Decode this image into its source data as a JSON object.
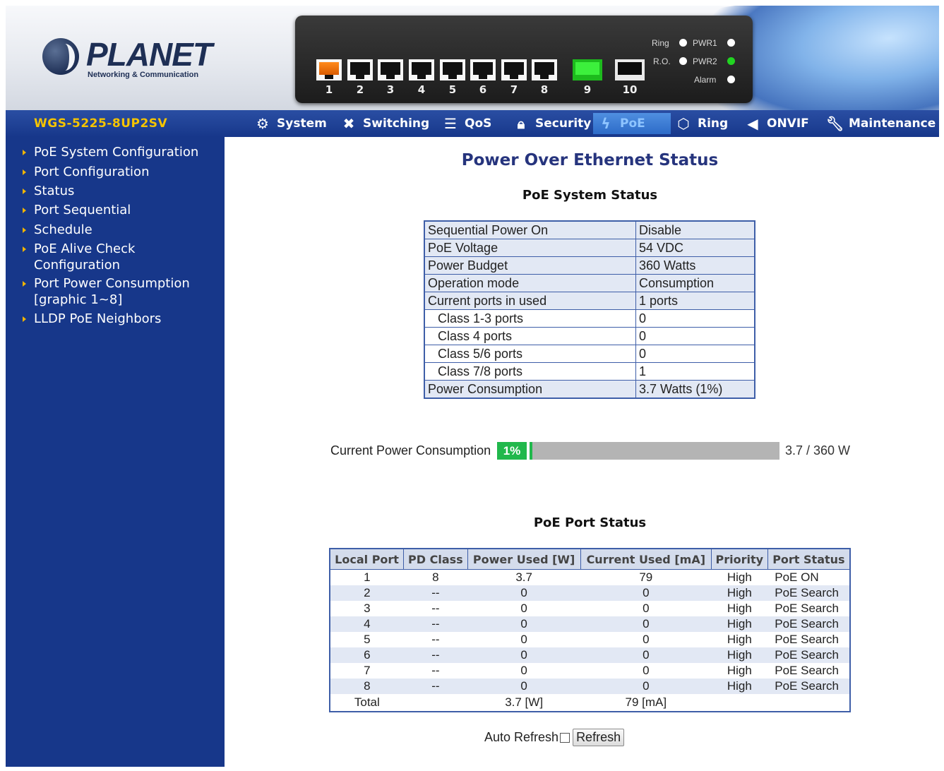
{
  "brand": {
    "name": "PLANET",
    "tagline": "Networking & Communication"
  },
  "device_panel": {
    "ports": [
      "1",
      "2",
      "3",
      "4",
      "5",
      "6",
      "7",
      "8",
      "9",
      "10"
    ],
    "active_port": "1",
    "leds": [
      {
        "label": "Ring",
        "state": "white"
      },
      {
        "label": "R.O.",
        "state": "white"
      },
      {
        "label": "PWR1",
        "state": "white"
      },
      {
        "label": "PWR2",
        "state": "green"
      },
      {
        "label": "Alarm",
        "state": "white"
      }
    ]
  },
  "header": {
    "model": "WGS-5225-8UP2SV",
    "nav": [
      {
        "label": "System",
        "icon": "gear-icon"
      },
      {
        "label": "Switching",
        "icon": "switching-icon"
      },
      {
        "label": "QoS",
        "icon": "qos-icon"
      },
      {
        "label": "Security",
        "icon": "lock-icon"
      },
      {
        "label": "PoE",
        "icon": "poe-icon",
        "current": true
      },
      {
        "label": "Ring",
        "icon": "ring-icon"
      },
      {
        "label": "ONVIF",
        "icon": "camera-icon"
      },
      {
        "label": "Maintenance",
        "icon": "wrench-icon"
      }
    ]
  },
  "sidebar": {
    "items": [
      {
        "label": "PoE System Configuration"
      },
      {
        "label": "Port Configuration"
      },
      {
        "label": "Status"
      },
      {
        "label": "Port Sequential"
      },
      {
        "label": "Schedule"
      },
      {
        "label": "PoE Alive Check\nConfiguration"
      },
      {
        "label": "Port Power Consumption\n[graphic 1~8]"
      },
      {
        "label": "LLDP PoE Neighbors"
      }
    ]
  },
  "main": {
    "title": "Power Over Ethernet Status",
    "system_status": {
      "title": "PoE System Status",
      "rows": [
        {
          "key": "Sequential Power On",
          "value": "Disable"
        },
        {
          "key": "PoE Voltage",
          "value": "54 VDC"
        },
        {
          "key": "Power Budget",
          "value": "360 Watts"
        },
        {
          "key": "Operation mode",
          "value": "Consumption"
        },
        {
          "key": "Current ports in used",
          "value": "1 ports"
        },
        {
          "key": "Class 1-3 ports",
          "value": "0"
        },
        {
          "key": "Class 4 ports",
          "value": "0"
        },
        {
          "key": "Class 5/6 ports",
          "value": "0"
        },
        {
          "key": "Class 7/8 ports",
          "value": "1"
        },
        {
          "key": "Power Consumption",
          "value": "3.7 Watts (1%)"
        }
      ]
    },
    "power_consumption": {
      "label": "Current Power Consumption",
      "percent_text": "1%",
      "fraction": 0.01,
      "value_text": "3.7 / 360 W"
    },
    "port_status": {
      "title": "PoE Port Status",
      "columns": [
        "Local Port",
        "PD Class",
        "Power Used [W]",
        "Current Used [mA]",
        "Priority",
        "Port Status"
      ],
      "rows": [
        [
          "1",
          "8",
          "3.7",
          "79",
          "High",
          "PoE ON"
        ],
        [
          "2",
          "--",
          "0",
          "0",
          "High",
          "PoE Search"
        ],
        [
          "3",
          "--",
          "0",
          "0",
          "High",
          "PoE Search"
        ],
        [
          "4",
          "--",
          "0",
          "0",
          "High",
          "PoE Search"
        ],
        [
          "5",
          "--",
          "0",
          "0",
          "High",
          "PoE Search"
        ],
        [
          "6",
          "--",
          "0",
          "0",
          "High",
          "PoE Search"
        ],
        [
          "7",
          "--",
          "0",
          "0",
          "High",
          "PoE Search"
        ],
        [
          "8",
          "--",
          "0",
          "0",
          "High",
          "PoE Search"
        ]
      ],
      "total": {
        "label": "Total",
        "power": "3.7 [W]",
        "current": "79 [mA]"
      }
    },
    "refresh": {
      "auto_label": "Auto Refresh",
      "auto_checked": false,
      "button_label": "Refresh"
    }
  },
  "colors": {
    "nav_bg": "#17378a",
    "model_text": "#f5c400",
    "title_text": "#26347d",
    "table_border": "#3e5ea8",
    "progress_green": "#21b84c",
    "progress_track": "#b4b4b4"
  }
}
